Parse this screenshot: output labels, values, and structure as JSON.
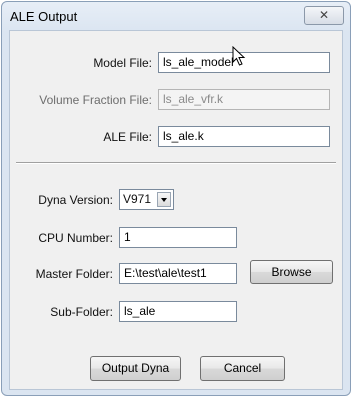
{
  "window": {
    "title": "ALE Output",
    "close_glyph": "✕"
  },
  "files": {
    "model_label": "Model File:",
    "model_value": "ls_ale_model",
    "vfr_label": "Volume Fraction File:",
    "vfr_value": "ls_ale_vfr.k",
    "ale_label": "ALE File:",
    "ale_value": "ls_ale.k"
  },
  "settings": {
    "dyna_version_label": "Dyna Version:",
    "dyna_version_value": "V971",
    "cpu_label": "CPU Number:",
    "cpu_value": "1",
    "master_label": "Master Folder:",
    "master_value": "E:\\test\\ale\\test1",
    "browse_label": "Browse",
    "sub_label": "Sub-Folder:",
    "sub_value": "ls_ale"
  },
  "actions": {
    "output_label": "Output Dyna",
    "cancel_label": "Cancel"
  },
  "icons": {
    "cursor": "mouse-pointer-icon",
    "dropdown": "chevron-down-icon",
    "close": "close-icon"
  }
}
